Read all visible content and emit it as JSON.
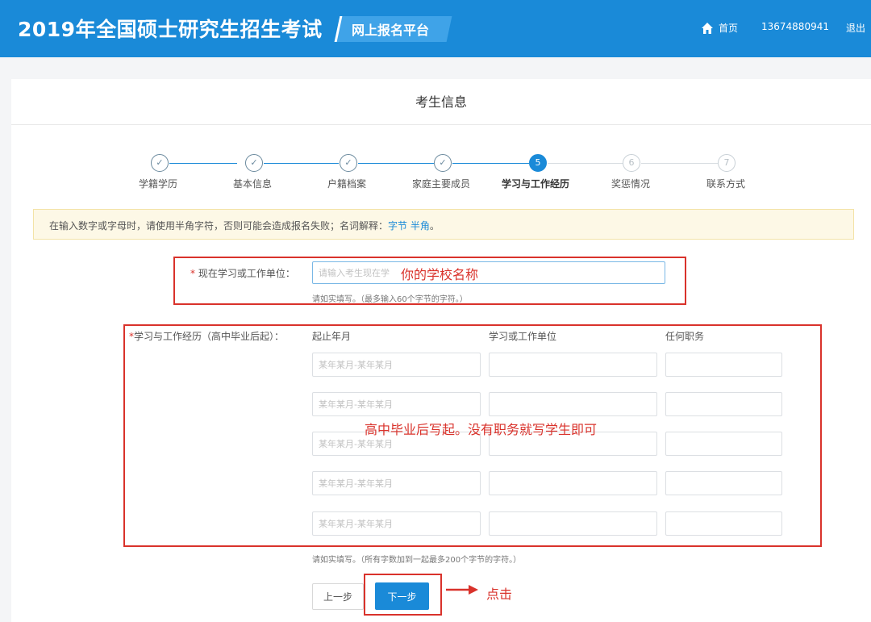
{
  "header": {
    "title": "2019年全国硕士研究生招生考试",
    "platform": "网上报名平台",
    "home": "首页",
    "phone": "13674880941",
    "logout": "退出"
  },
  "page_title": "考生信息",
  "steps": [
    {
      "label": "学籍学历",
      "mark": "✓",
      "state": "done"
    },
    {
      "label": "基本信息",
      "mark": "✓",
      "state": "done"
    },
    {
      "label": "户籍档案",
      "mark": "✓",
      "state": "done"
    },
    {
      "label": "家庭主要成员",
      "mark": "✓",
      "state": "done"
    },
    {
      "label": "学习与工作经历",
      "mark": "5",
      "state": "active"
    },
    {
      "label": "奖惩情况",
      "mark": "6",
      "state": "todo"
    },
    {
      "label": "联系方式",
      "mark": "7",
      "state": "todo"
    }
  ],
  "notice": {
    "text": "在输入数字或字母时，请使用半角字符，否则可能会造成报名失败；名词解释：",
    "link1": "字节",
    "link2": "半角",
    "end": "。"
  },
  "current_unit": {
    "required": "*",
    "label": "现在学习或工作单位：",
    "placeholder": "请输入考生现在学",
    "hint": "请如实填写。（最多输入60个字节的字符。）"
  },
  "history": {
    "required": "*",
    "label": "学习与工作经历（高中毕业后起）：",
    "columns": [
      "起止年月",
      "学习或工作单位",
      "任何职务"
    ],
    "date_placeholder": "某年某月-某年某月",
    "row_count_label": "5",
    "hint": "请如实填写。（所有字数加到一起最多200个字节的字符。）"
  },
  "annotations": {
    "school": "你的学校名称",
    "history": "高中毕业后写起。没有职务就写学生即可",
    "click": "点击"
  },
  "buttons": {
    "prev": "上一步",
    "next": "下一步"
  },
  "colors": {
    "brand": "#1a8ad8",
    "annotation": "#d9322b"
  }
}
